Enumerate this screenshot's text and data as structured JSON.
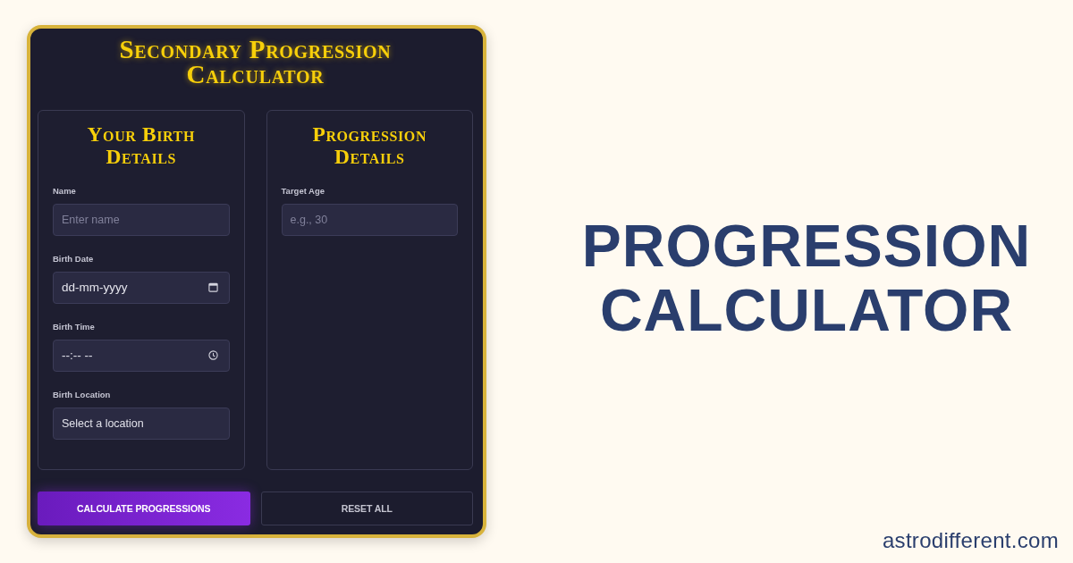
{
  "calculator": {
    "title": "Secondary Progression Calculator",
    "panels": [
      {
        "title": "Your Birth Details",
        "fields": [
          {
            "kind": "text",
            "label": "Name",
            "placeholder": "Enter name"
          },
          {
            "kind": "date",
            "label": "Birth Date",
            "placeholder": "dd-mm-yyyy"
          },
          {
            "kind": "time",
            "label": "Birth Time",
            "placeholder": "--:-- --"
          },
          {
            "kind": "select",
            "label": "Birth Location",
            "value": "Select a location"
          }
        ]
      },
      {
        "title": "Progression Details",
        "fields": [
          {
            "kind": "number",
            "label": "Target Age",
            "placeholder": "e.g., 30"
          }
        ]
      }
    ],
    "buttons": [
      {
        "kind": "primary",
        "label": "CALCULATE PROGRESSIONS"
      },
      {
        "kind": "secondary",
        "label": "RESET ALL"
      }
    ]
  },
  "headline": "PROGRESSION CALCULATOR",
  "site": "astrodifferent.com"
}
